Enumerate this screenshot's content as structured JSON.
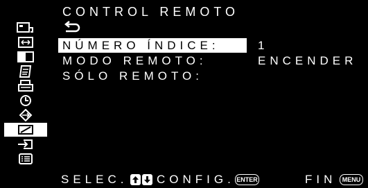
{
  "title": "CONTROL REMOTO",
  "menu": {
    "rows": [
      {
        "label": "NÚMERO ÍNDICE:",
        "value": "1",
        "selected": true
      },
      {
        "label": "MODO REMOTO:",
        "value": "ENCENDER",
        "selected": false
      },
      {
        "label": "SÓLO REMOTO:",
        "value": "",
        "selected": false
      }
    ]
  },
  "sidebar": {
    "icons": [
      "picture-adjust-icon",
      "screen-adjust-icon",
      "dual-picture-icon",
      "memo-icon",
      "printer-icon",
      "timer-icon",
      "connection-icon",
      "remote-control-icon",
      "input-icon",
      "list-icon"
    ],
    "active_index": 7
  },
  "footer": {
    "select_label": "SELEC.",
    "config_label": "CONFIG.",
    "enter_key": "ENTER",
    "end_label": "FIN",
    "menu_key": "MENU"
  }
}
